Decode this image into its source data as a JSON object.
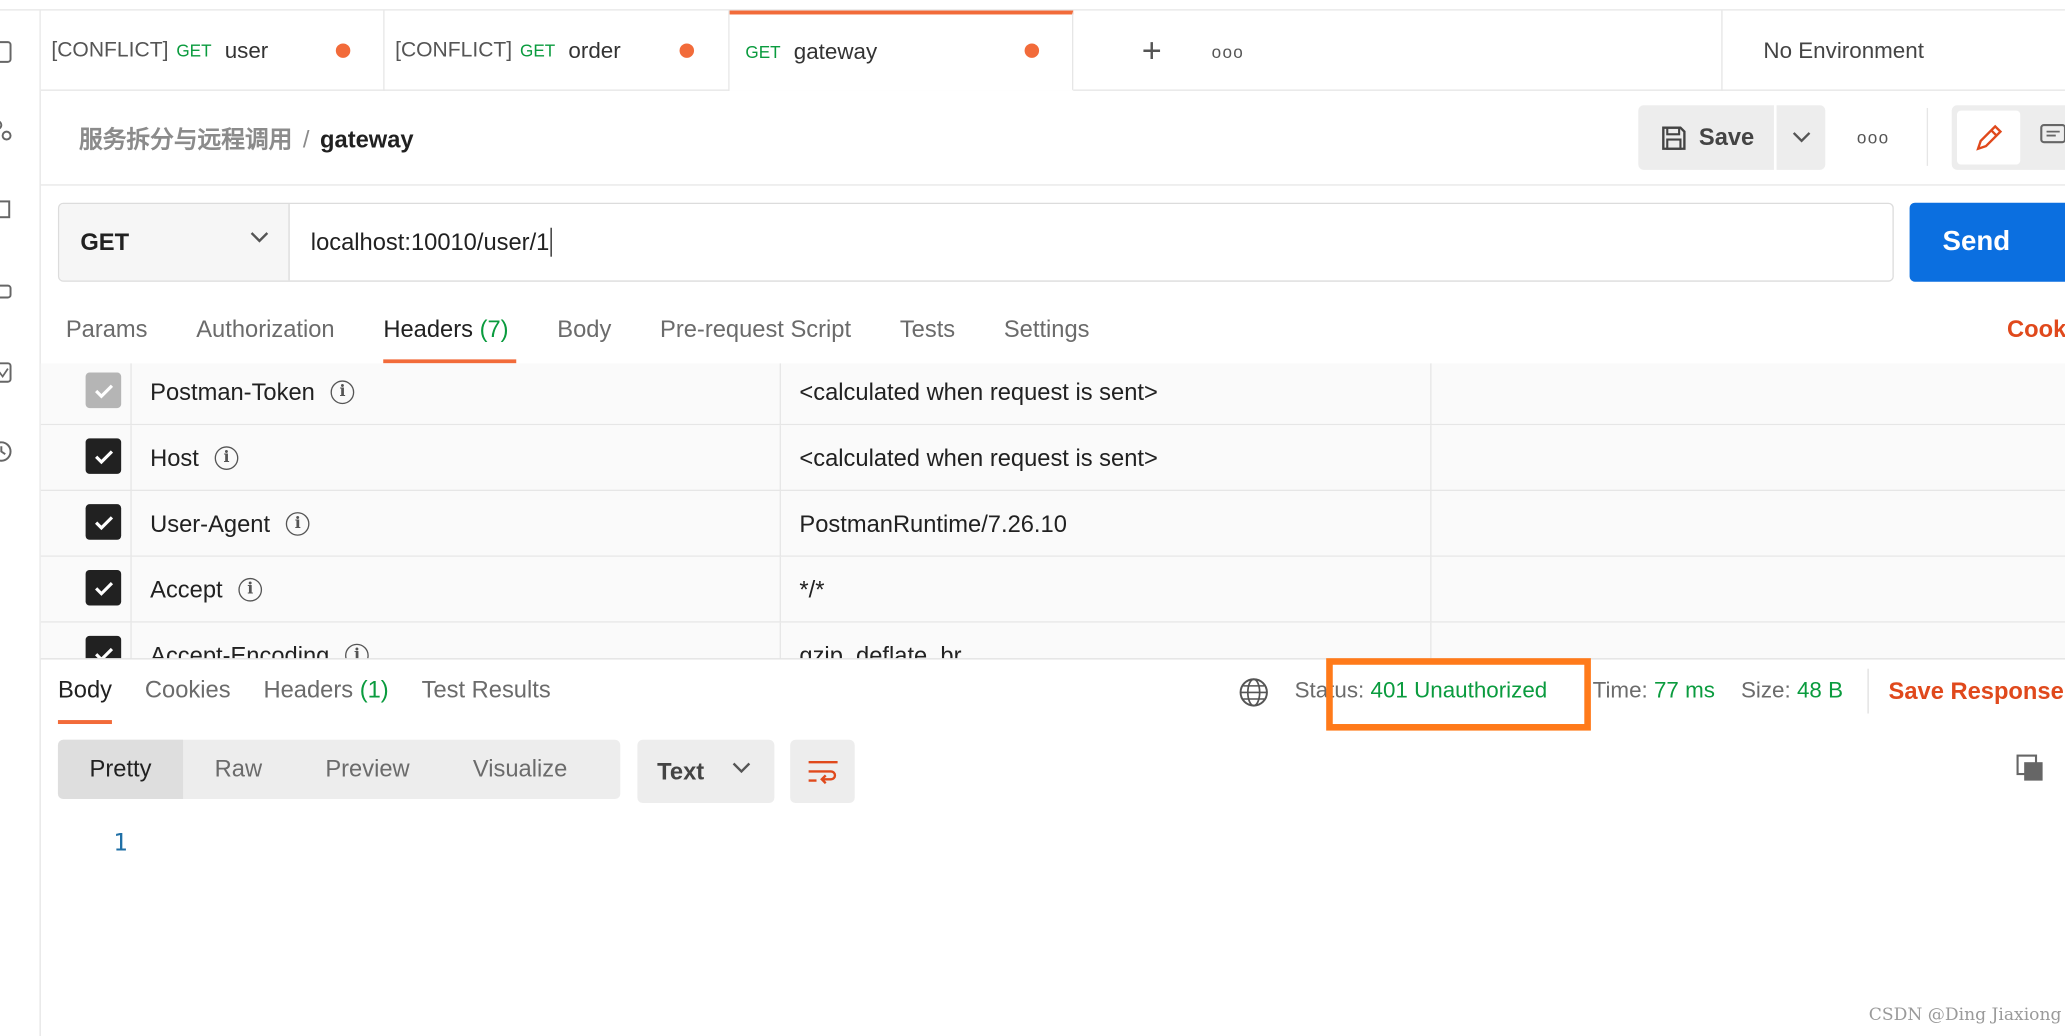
{
  "tabs": [
    {
      "conflict": "[CONFLICT]",
      "method": "GET",
      "name": "user"
    },
    {
      "conflict": "[CONFLICT]",
      "method": "GET",
      "name": "order"
    },
    {
      "conflict": "",
      "method": "GET",
      "name": "gateway"
    }
  ],
  "environment": "No Environment",
  "breadcrumb": {
    "parent": "服务拆分与远程调用",
    "separator": "/",
    "current": "gateway"
  },
  "toolbar": {
    "save_label": "Save"
  },
  "request": {
    "method": "GET",
    "url": "localhost:10010/user/1",
    "send_label": "Send"
  },
  "request_tabs": [
    {
      "label": "Params",
      "count": ""
    },
    {
      "label": "Authorization",
      "count": ""
    },
    {
      "label": "Headers",
      "count": "(7)"
    },
    {
      "label": "Body",
      "count": ""
    },
    {
      "label": "Pre-request Script",
      "count": ""
    },
    {
      "label": "Tests",
      "count": ""
    },
    {
      "label": "Settings",
      "count": ""
    }
  ],
  "cookies_label": "Cook",
  "headers": [
    {
      "key": "Postman-Token",
      "value": "<calculated when request is sent>",
      "checked": true
    },
    {
      "key": "Host",
      "value": "<calculated when request is sent>",
      "checked": true
    },
    {
      "key": "User-Agent",
      "value": "PostmanRuntime/7.26.10",
      "checked": true
    },
    {
      "key": "Accept",
      "value": "*/*",
      "checked": true
    },
    {
      "key": "Accept-Encoding",
      "value": "gzip, deflate, br",
      "checked": true
    }
  ],
  "response_tabs": [
    {
      "label": "Body",
      "count": ""
    },
    {
      "label": "Cookies",
      "count": ""
    },
    {
      "label": "Headers",
      "count": "(1)"
    },
    {
      "label": "Test Results",
      "count": ""
    }
  ],
  "response": {
    "status_label": "Status:",
    "status_value": "401 Unauthorized",
    "time_label": "Time:",
    "time_value": "77 ms",
    "size_label": "Size:",
    "size_value": "48 B",
    "save_label": "Save Response"
  },
  "view_modes": [
    "Pretty",
    "Raw",
    "Preview",
    "Visualize"
  ],
  "format": "Text",
  "line_number": "1",
  "watermark": "CSDN @Ding Jiaxiong",
  "colors": {
    "accent": "#f26b3a",
    "send": "#0b6fe0",
    "status_ok": "#0a9b3e",
    "highlight": "#ff7a1a"
  }
}
